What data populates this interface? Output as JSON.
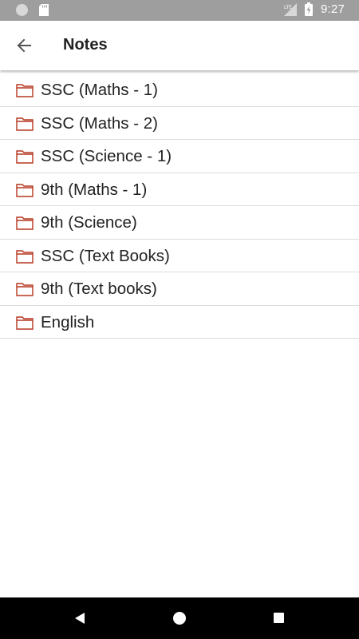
{
  "status_bar": {
    "time": "9:27",
    "icons": [
      "notification-dot-icon",
      "sd-card-icon",
      "lte-signal-icon",
      "battery-charging-icon"
    ]
  },
  "app_bar": {
    "title": "Notes",
    "back_icon": "arrow-back-icon"
  },
  "list": {
    "items": [
      {
        "label": "SSC (Maths - 1)",
        "icon": "folder-icon"
      },
      {
        "label": "SSC (Maths - 2)",
        "icon": "folder-icon"
      },
      {
        "label": "SSC (Science - 1)",
        "icon": "folder-icon"
      },
      {
        "label": "9th (Maths - 1)",
        "icon": "folder-icon"
      },
      {
        "label": "9th (Science)",
        "icon": "folder-icon"
      },
      {
        "label": "SSC (Text Books)",
        "icon": "folder-icon"
      },
      {
        "label": "9th (Text books)",
        "icon": "folder-icon"
      },
      {
        "label": "English",
        "icon": "folder-icon"
      }
    ]
  },
  "nav_bar": {
    "buttons": [
      "nav-back-icon",
      "nav-home-icon",
      "nav-recents-icon"
    ]
  },
  "colors": {
    "status_bar_bg": "#9e9e9e",
    "app_bar_bg": "#ffffff",
    "folder_outline": "#b5371e",
    "divider": "#dcdcdc",
    "nav_bar_bg": "#000000"
  }
}
